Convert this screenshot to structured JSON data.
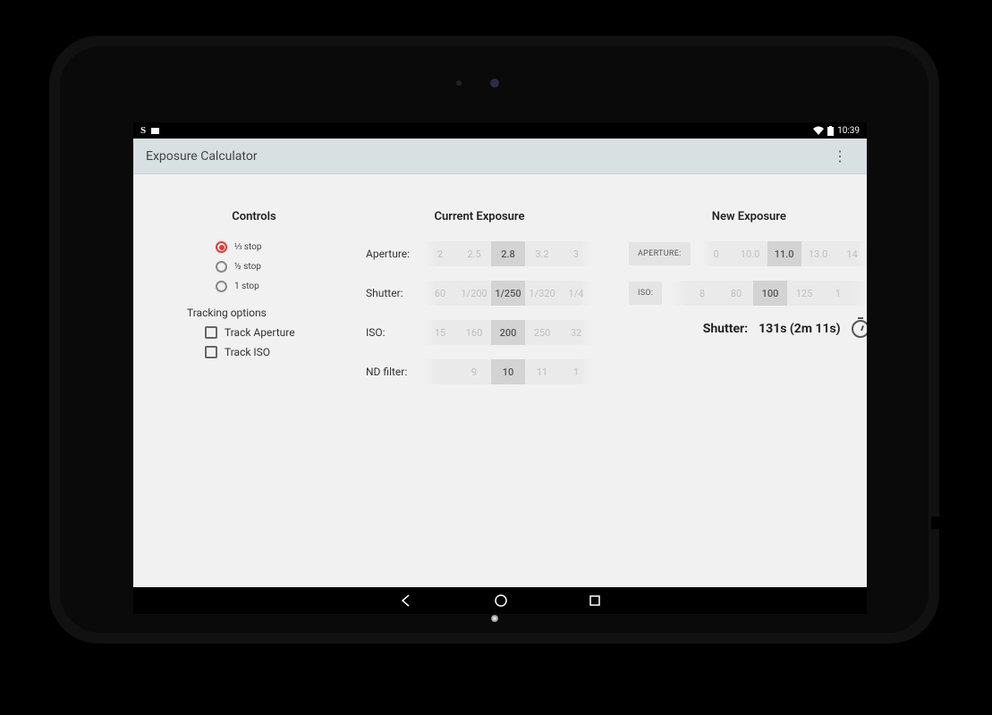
{
  "status": {
    "time": "10:39"
  },
  "app": {
    "title": "Exposure Calculator"
  },
  "controls": {
    "title": "Controls",
    "stops": [
      {
        "label": "⅓ stop",
        "checked": true
      },
      {
        "label": "½ stop",
        "checked": false
      },
      {
        "label": "1 stop",
        "checked": false
      }
    ],
    "tracking_title": "Tracking options",
    "track_aperture": "Track Aperture",
    "track_iso": "Track ISO"
  },
  "current": {
    "title": "Current Exposure",
    "aperture": {
      "label": "Aperture:",
      "items": [
        "2",
        "2.5",
        "2.8",
        "3.2",
        "3"
      ],
      "selected_index": 2
    },
    "shutter": {
      "label": "Shutter:",
      "items": [
        "60",
        "1/200",
        "1/250",
        "1/320",
        "1/4"
      ],
      "selected_index": 2
    },
    "iso": {
      "label": "ISO:",
      "items": [
        "15",
        "160",
        "200",
        "250",
        "32"
      ],
      "selected_index": 2
    },
    "nd": {
      "label": "ND filter:",
      "items": [
        "",
        "9",
        "10",
        "11",
        "1"
      ],
      "selected_index": 2
    }
  },
  "new_exposure": {
    "title": "New Exposure",
    "aperture": {
      "chip": "APERTURE:",
      "items": [
        "0",
        "10.0",
        "11.0",
        "13.0",
        "14"
      ],
      "selected_index": 2
    },
    "iso": {
      "chip": "ISO:",
      "items": [
        "8",
        "80",
        "100",
        "125",
        "1"
      ],
      "selected_index": 2
    },
    "result_label": "Shutter:",
    "result_value": "131s (2m 11s)"
  }
}
